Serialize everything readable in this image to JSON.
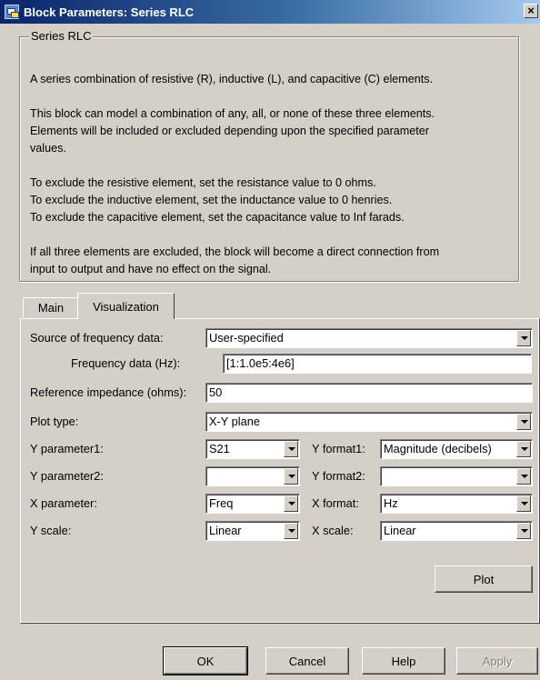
{
  "window": {
    "title": "Block Parameters: Series RLC",
    "close_symbol": "×"
  },
  "group": {
    "legend": "Series RLC",
    "description": [
      "A series combination of resistive (R), inductive (L), and capacitive (C) elements.",
      "This block can model a combination of any, all, or none of these three elements.",
      "Elements will be included or excluded depending upon the specified parameter",
      "values.",
      "To exclude the resistive element, set the resistance value to 0 ohms.",
      "To exclude the inductive element, set the inductance value to 0 henries.",
      "To exclude the capacitive element, set the capacitance value to Inf farads.",
      "If all three elements are excluded, the block will become a direct connection from",
      "input to output and have no effect on the signal."
    ]
  },
  "tabs": [
    {
      "label": "Main",
      "active": false
    },
    {
      "label": "Visualization",
      "active": true
    }
  ],
  "visualization": {
    "source_freq_label": "Source of frequency data:",
    "source_freq_value": "User-specified",
    "freq_data_label": "Frequency data (Hz):",
    "freq_data_value": "[1:1.0e5:4e6]",
    "ref_impedance_label": "Reference impedance (ohms):",
    "ref_impedance_value": "50",
    "plot_type_label": "Plot type:",
    "plot_type_value": "X-Y plane",
    "y_param1_label": "Y parameter1:",
    "y_param1_value": "S21",
    "y_format1_label": "Y format1:",
    "y_format1_value": "Magnitude (decibels)",
    "y_param2_label": "Y parameter2:",
    "y_param2_value": "",
    "y_format2_label": "Y format2:",
    "y_format2_value": "",
    "x_param_label": "X parameter:",
    "x_param_value": "Freq",
    "x_format_label": "X format:",
    "x_format_value": "Hz",
    "y_scale_label": "Y scale:",
    "y_scale_value": "Linear",
    "x_scale_label": "X scale:",
    "x_scale_value": "Linear",
    "plot_button": "Plot"
  },
  "buttons": {
    "ok": "OK",
    "cancel": "Cancel",
    "help": "Help",
    "apply": "Apply"
  }
}
